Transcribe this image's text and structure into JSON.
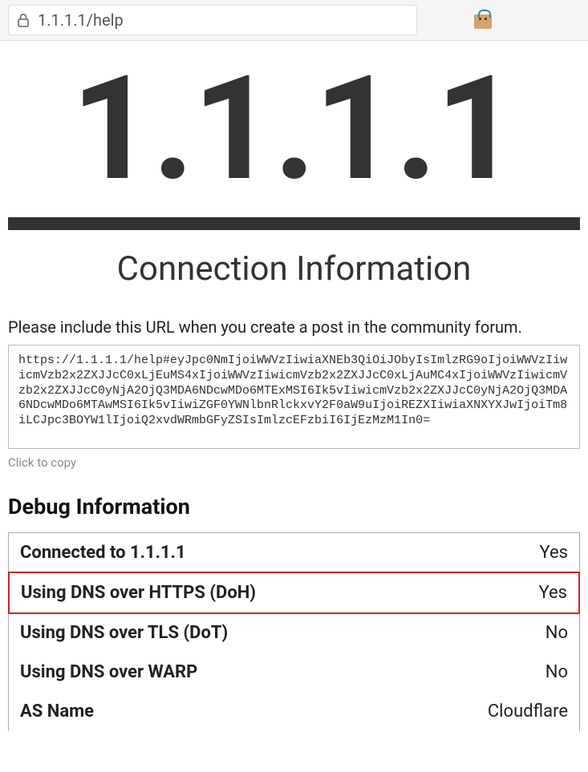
{
  "browser": {
    "url": "1.1.1.1/help"
  },
  "page": {
    "title": "1.1.1.1",
    "subtitle": "Connection Information",
    "instruction": "Please include this URL when you create a post in the community forum.",
    "url_payload": "https://1.1.1.1/help#eyJpc0NmIjoiWWVzIiwiaXNEb3QiOiJObyIsImlzRG9oIjoiWWVzIiwicmVzb2x2ZXJJcC0xLjEuMS4xIjoiWWVzIiwicmVzb2x2ZXJJcC0xLjAuMC4xIjoiWWVzIiwicmVzb2x2ZXJJcC0yNjA2OjQ3MDA6NDcwMDo6MTExMSI6Ik5vIiwicmVzb2x2ZXJJcC0yNjA2OjQ3MDA6NDcwMDo6MTAwMSI6Ik5vIiwiZGF0YWNlbnRlckxvY2F0aW9uIjoiREZXIiwiaXNXYXJwIjoiTm8iLCJpc3BOYW1lIjoiQ2xvdWRmbGFyZSIsImlzcEFzbiI6IjEzMzM1In0=",
    "click_to_copy": "Click to copy",
    "debug_heading": "Debug Information",
    "debug_rows": [
      {
        "label": "Connected to 1.1.1.1",
        "value": "Yes",
        "highlight": false
      },
      {
        "label": "Using DNS over HTTPS (DoH)",
        "value": "Yes",
        "highlight": true
      },
      {
        "label": "Using DNS over TLS (DoT)",
        "value": "No",
        "highlight": false
      },
      {
        "label": "Using DNS over WARP",
        "value": "No",
        "highlight": false
      },
      {
        "label": "AS Name",
        "value": "Cloudflare",
        "highlight": false
      }
    ]
  }
}
